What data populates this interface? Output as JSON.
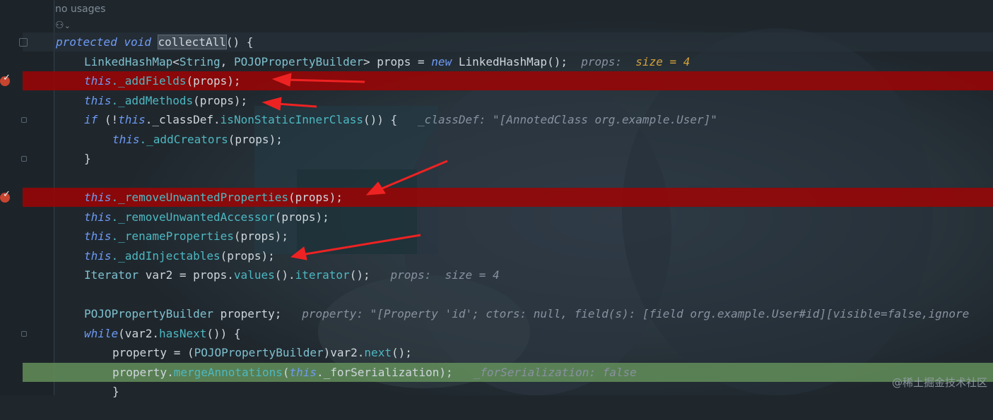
{
  "header": {
    "usages": "no usages",
    "author_icon": "users-icon"
  },
  "watermark": "@稀土掘金技术社区",
  "code": {
    "sig_kw1": "protected",
    "sig_kw2": "void",
    "sig_name": "collectAll",
    "sig_rest": "() {",
    "l2_type1": "LinkedHashMap",
    "l2_gen_open": "<",
    "l2_type2": "String",
    "l2_comma": ", ",
    "l2_type3": "POJOPropertyBuilder",
    "l2_gen_close": "> props = ",
    "l2_new": "new",
    "l2_ctor": " LinkedHashMap();",
    "l2_hint": "props:",
    "l2_size": "size = 4",
    "l3_this": "this",
    "l3_call": "._addFields",
    "l3_args": "(props);",
    "l4_this": "this",
    "l4_call": "._addMethods",
    "l4_args": "(props);",
    "l5_if": "if",
    "l5_open": " (!",
    "l5_this": "this",
    "l5_field": "._classDef.",
    "l5_call": "isNonStaticInnerClass",
    "l5_close": "()) {",
    "l5_hint": "_classDef: \"[AnnotedClass org.example.User]\"",
    "l6_this": "this",
    "l6_call": "._addCreators",
    "l6_args": "(props);",
    "l7": "}",
    "l9_this": "this",
    "l9_call": "._removeUnwantedProperties",
    "l9_args": "(props);",
    "l10_this": "this",
    "l10_call": "._removeUnwantedAccessor",
    "l10_args": "(props);",
    "l11_this": "this",
    "l11_call": "._renameProperties",
    "l11_args": "(props);",
    "l12_this": "this",
    "l12_call": "._addInjectables",
    "l12_args": "(props);",
    "l13_type": "Iterator",
    "l13_mid": " var2 = props.",
    "l13_m1": "values",
    "l13_p1": "().",
    "l13_m2": "iterator",
    "l13_p2": "();",
    "l13_hint": "props:  size = 4",
    "l15_type": "POJOPropertyBuilder",
    "l15_rest": " property;",
    "l15_hint": "property: \"[Property 'id'; ctors: null, field(s): [field org.example.User#id][visible=false,ignore",
    "l16_kw": "while",
    "l16_open": "(var2.",
    "l16_call": "hasNext",
    "l16_close": "()) {",
    "l17_a": "property = (",
    "l17_type": "POJOPropertyBuilder",
    "l17_b": ")var2.",
    "l17_call": "next",
    "l17_c": "();",
    "l18_a": "property.",
    "l18_call": "mergeAnnotations",
    "l18_b": "(",
    "l18_this": "this",
    "l18_c": "._forSerialization",
    "l18_d": ");",
    "l18_hint": "_forSerialization: false",
    "l19": "}"
  }
}
